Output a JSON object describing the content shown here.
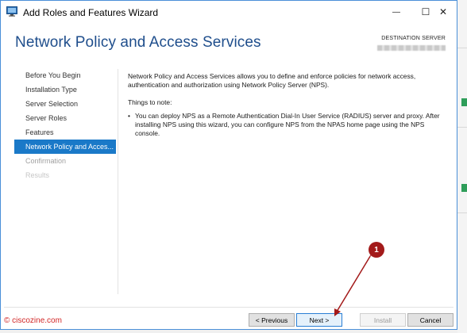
{
  "window": {
    "title": "Add Roles and Features Wizard",
    "minimize_glyph": "—",
    "maximize_glyph": "☐",
    "close_glyph": "✕"
  },
  "header": {
    "title": "Network Policy and Access Services",
    "destination_label": "DESTINATION SERVER"
  },
  "nav": {
    "items": [
      {
        "label": "Before You Begin",
        "state": "normal"
      },
      {
        "label": "Installation Type",
        "state": "normal"
      },
      {
        "label": "Server Selection",
        "state": "normal"
      },
      {
        "label": "Server Roles",
        "state": "normal"
      },
      {
        "label": "Features",
        "state": "normal"
      },
      {
        "label": "Network Policy and Acces...",
        "state": "active"
      },
      {
        "label": "Confirmation",
        "state": "disabled"
      },
      {
        "label": "Results",
        "state": "dim"
      }
    ]
  },
  "content": {
    "intro": "Network Policy and Access Services allows you to define and enforce policies for network access, authentication and authorization using Network Policy Server (NPS).",
    "things_to_note": "Things to note:",
    "bullet": "•",
    "note": "You can deploy NPS as a Remote Authentication Dial-In User Service (RADIUS) server and proxy. After installing NPS using this wizard,  you can configure NPS from the NPAS home page using the NPS console."
  },
  "footer": {
    "watermark": "© ciscozine.com",
    "previous_label": "< Previous",
    "next_label": "Next >",
    "install_label": "Install",
    "cancel_label": "Cancel"
  },
  "annotation": {
    "badge_number": "1",
    "color": "#a31a1a"
  }
}
